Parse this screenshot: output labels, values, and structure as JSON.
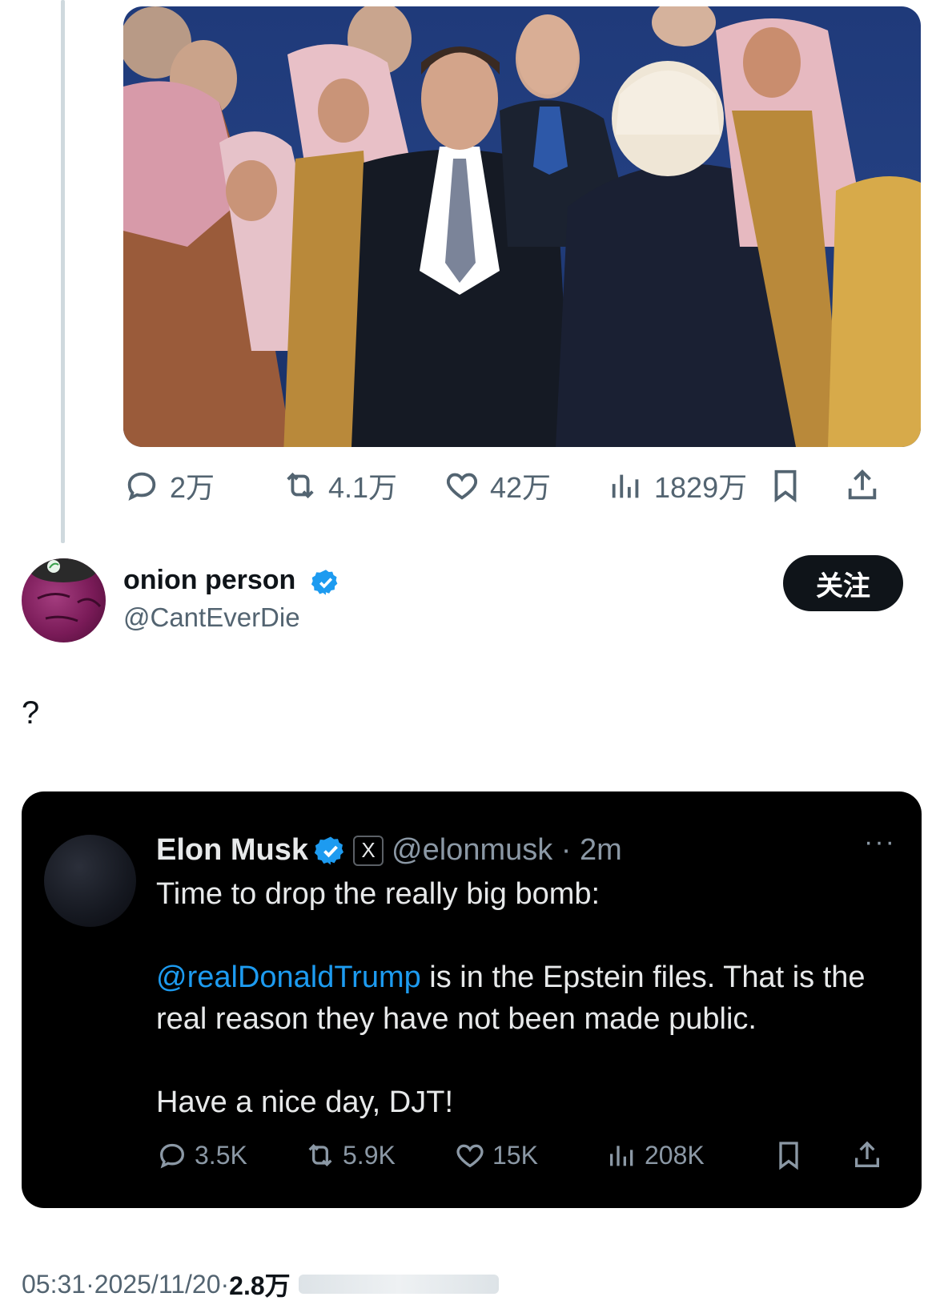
{
  "colors": {
    "accent": "#1d9bf0",
    "text_primary": "#0f1419",
    "text_secondary": "#536471",
    "card_bg": "#000000"
  },
  "top_tweet": {
    "image_alt": "Elon Musk and Donald Trump among Saudi delegates",
    "actions": {
      "reply": {
        "icon": "reply-icon",
        "count": "2万"
      },
      "retweet": {
        "icon": "retweet-icon",
        "count": "4.1万"
      },
      "like": {
        "icon": "heart-icon",
        "count": "42万"
      },
      "views": {
        "icon": "views-icon",
        "count": "1829万"
      },
      "bookmark": {
        "icon": "bookmark-icon"
      },
      "share": {
        "icon": "share-icon"
      }
    }
  },
  "author": {
    "display_name": "onion person",
    "handle": "@CantEverDie",
    "verified": true,
    "follow_label": "关注"
  },
  "tweet": {
    "text": "?"
  },
  "quoted": {
    "name": "Elon Musk",
    "verified": true,
    "badge": "X",
    "handle": "@elonmusk · 2m",
    "more": "···",
    "line1": "Time to drop the really big bomb:",
    "mention": "@realDonaldTrump",
    "line2_rest": " is in the Epstein files. That is the real reason they have not been made public.",
    "line3": "Have a nice day, DJT!",
    "actions": {
      "reply": "3.5K",
      "retweet": "5.9K",
      "like": "15K",
      "views": "208K"
    }
  },
  "meta": {
    "time": "05:31",
    "date": "2025/11/20",
    "views": "2.8万",
    "sep": " · "
  }
}
